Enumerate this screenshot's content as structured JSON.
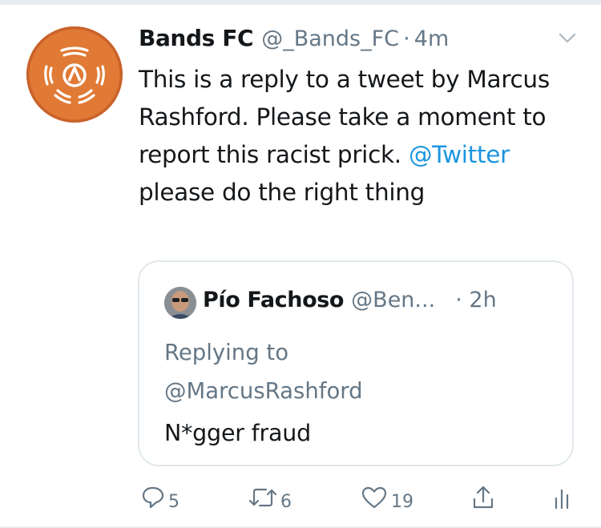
{
  "tweet": {
    "display_name": "Bands FC",
    "handle": "@_Bands_FC",
    "separator": "·",
    "time": "4m",
    "text_before_mention": "This is a reply to a tweet by Marcus Rashford. Please take a moment to report this racist prick. ",
    "mention": "@Twitter",
    "text_after_mention": " please do the right thing"
  },
  "quoted_tweet": {
    "display_name": "Pío Fachoso",
    "handle": "@Ben...",
    "time": "· 2h",
    "replying_to_label": "Replying to",
    "replying_to_handle": "@MarcusRashford",
    "text": "N*gger fraud"
  },
  "actions": {
    "reply_count": "5",
    "retweet_count": "6",
    "like_count": "19"
  },
  "colors": {
    "link": "#1b95e0",
    "secondary_text": "#657786",
    "avatar_orange": "#e07a35",
    "border": "#e1e8ed"
  },
  "icons": {
    "reply": "reply-icon",
    "retweet": "retweet-icon",
    "like": "heart-icon",
    "share": "share-icon",
    "analytics": "analytics-icon",
    "caret": "chevron-down-icon"
  }
}
